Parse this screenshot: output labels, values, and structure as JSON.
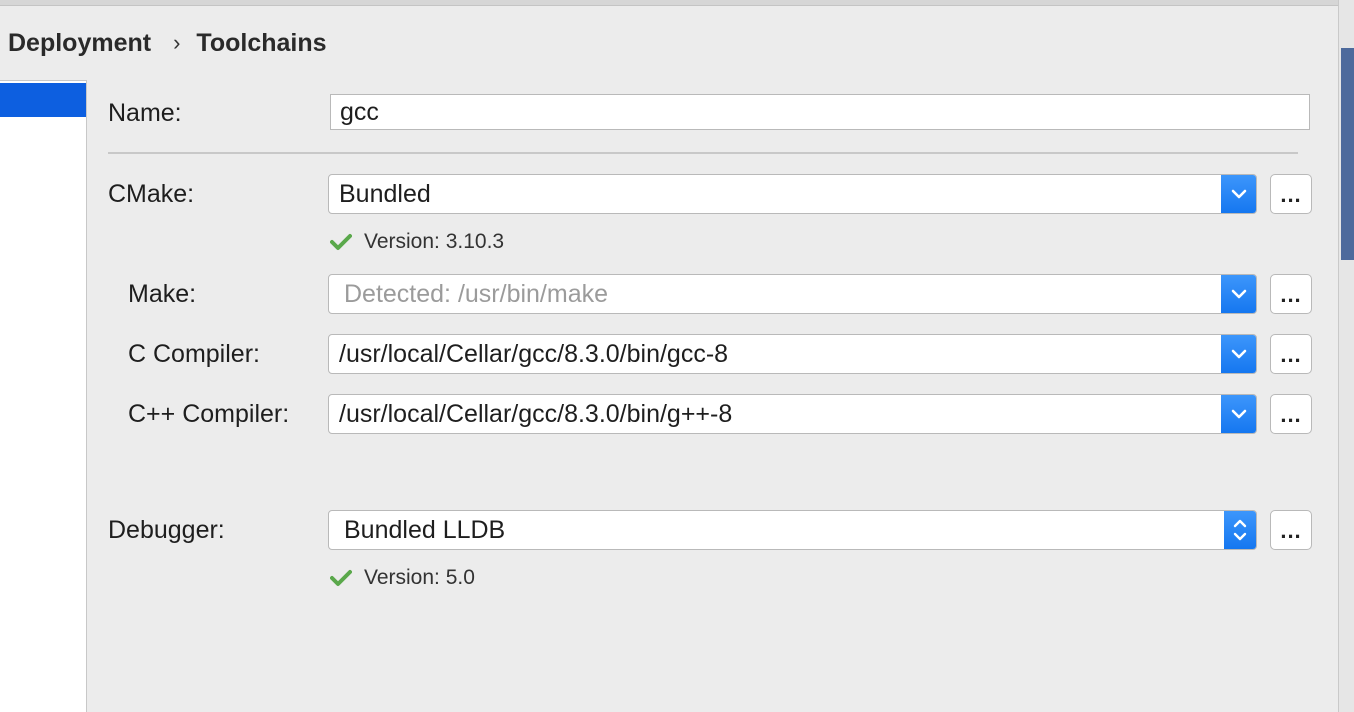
{
  "breadcrumb": {
    "parent": "Deployment",
    "separator": "›",
    "current": "Toolchains"
  },
  "form": {
    "name": {
      "label": "Name:",
      "value": "gcc"
    },
    "cmake": {
      "label": "CMake:",
      "value": "Bundled",
      "version": "Version: 3.10.3"
    },
    "make": {
      "label": "Make:",
      "placeholder": "Detected: /usr/bin/make"
    },
    "c_compiler": {
      "label": "C Compiler:",
      "value": "/usr/local/Cellar/gcc/8.3.0/bin/gcc-8"
    },
    "cpp_compiler": {
      "label": "C++ Compiler:",
      "value": "/usr/local/Cellar/gcc/8.3.0/bin/g++-8"
    },
    "debugger": {
      "label": "Debugger:",
      "value": "Bundled LLDB",
      "version": "Version: 5.0"
    },
    "browse_label": "..."
  },
  "colors": {
    "accent": "#1577f0",
    "selection": "#0d5fe0",
    "check": "#5aa84b"
  }
}
